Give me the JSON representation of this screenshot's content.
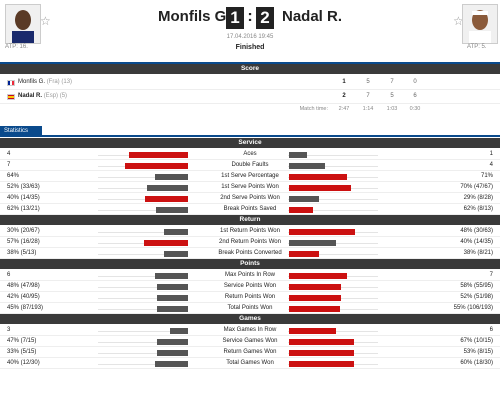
{
  "header": {
    "player1": {
      "name": "Monfils G.",
      "atp": "ATP: 16."
    },
    "player2": {
      "name": "Nadal R.",
      "atp": "ATP: 5."
    },
    "sets_p1": "1",
    "sets_p2": "2",
    "separator": ":",
    "date": "17.04.2016 19:45",
    "status": "Finished"
  },
  "score_section": {
    "title": "Score",
    "rows": [
      {
        "name": "Monfils G.",
        "country": "(Fra)",
        "rank": "(13)",
        "bold": false,
        "total": "1",
        "sets": [
          "5",
          "7",
          "0"
        ]
      },
      {
        "name": "Nadal R.",
        "country": "(Esp)",
        "rank": "(5)",
        "bold": true,
        "total": "2",
        "sets": [
          "7",
          "5",
          "6"
        ]
      }
    ],
    "match_time_label": "Match time:",
    "times": [
      "2:47",
      "1:14",
      "1:03",
      "0:30"
    ]
  },
  "statistics_tab": "Statistics",
  "colors": {
    "p1_win": "#cc1111",
    "p2_win": "#cc1111",
    "neutral": "#555555",
    "header_bg": "#3a3a3a",
    "accent": "#0a4a8c"
  },
  "stats": [
    {
      "section": "Service",
      "items": [
        {
          "name": "Aces",
          "left": "4",
          "right": "1",
          "lf": 0.66,
          "rf": 0.2,
          "lwin": true
        },
        {
          "name": "Double Faults",
          "left": "7",
          "right": "4",
          "lf": 0.7,
          "rf": 0.4,
          "lwin": true
        },
        {
          "name": "1st Serve Percentage",
          "left": "64%",
          "right": "71%",
          "lf": 0.37,
          "rf": 0.64,
          "lwin": false
        },
        {
          "name": "1st Serve Points Won",
          "left": "52% (33/63)",
          "right": "70% (47/67)",
          "lf": 0.45,
          "rf": 0.69,
          "lwin": false
        },
        {
          "name": "2nd Serve Points Won",
          "left": "40% (14/35)",
          "right": "29% (8/28)",
          "lf": 0.48,
          "rf": 0.33,
          "lwin": true
        },
        {
          "name": "Break Points Saved",
          "left": "62% (13/21)",
          "right": "62% (8/13)",
          "lf": 0.36,
          "rf": 0.27,
          "lwin": false
        }
      ]
    },
    {
      "section": "Return",
      "items": [
        {
          "name": "1st Return Points Won",
          "left": "30% (20/67)",
          "right": "48% (30/63)",
          "lf": 0.27,
          "rf": 0.73,
          "lwin": false
        },
        {
          "name": "2nd Return Points Won",
          "left": "57% (16/28)",
          "right": "40% (14/35)",
          "lf": 0.49,
          "rf": 0.52,
          "lwin": true
        },
        {
          "name": "Break Points Converted",
          "left": "38% (5/13)",
          "right": "38% (8/21)",
          "lf": 0.27,
          "rf": 0.33,
          "lwin": false
        }
      ]
    },
    {
      "section": "Points",
      "items": [
        {
          "name": "Max Points In Row",
          "left": "6",
          "right": "7",
          "lf": 0.37,
          "rf": 0.64,
          "lwin": false
        },
        {
          "name": "Service Points Won",
          "left": "48% (47/98)",
          "right": "58% (55/95)",
          "lf": 0.35,
          "rf": 0.58,
          "lwin": false
        },
        {
          "name": "Return Points Won",
          "left": "42% (40/95)",
          "right": "52% (51/98)",
          "lf": 0.35,
          "rf": 0.58,
          "lwin": false
        },
        {
          "name": "Total Points Won",
          "left": "45% (87/193)",
          "right": "55% (106/193)",
          "lf": 0.35,
          "rf": 0.57,
          "lwin": false
        }
      ]
    },
    {
      "section": "Games",
      "items": [
        {
          "name": "Max Games In Row",
          "left": "3",
          "right": "6",
          "lf": 0.2,
          "rf": 0.52,
          "lwin": false
        },
        {
          "name": "Service Games Won",
          "left": "47% (7/15)",
          "right": "67% (10/15)",
          "lf": 0.35,
          "rf": 0.72,
          "lwin": false
        },
        {
          "name": "Return Games Won",
          "left": "33% (5/15)",
          "right": "53% (8/15)",
          "lf": 0.35,
          "rf": 0.72,
          "lwin": false
        },
        {
          "name": "Total Games Won",
          "left": "40% (12/30)",
          "right": "60% (18/30)",
          "lf": 0.37,
          "rf": 0.72,
          "lwin": false
        }
      ]
    }
  ]
}
